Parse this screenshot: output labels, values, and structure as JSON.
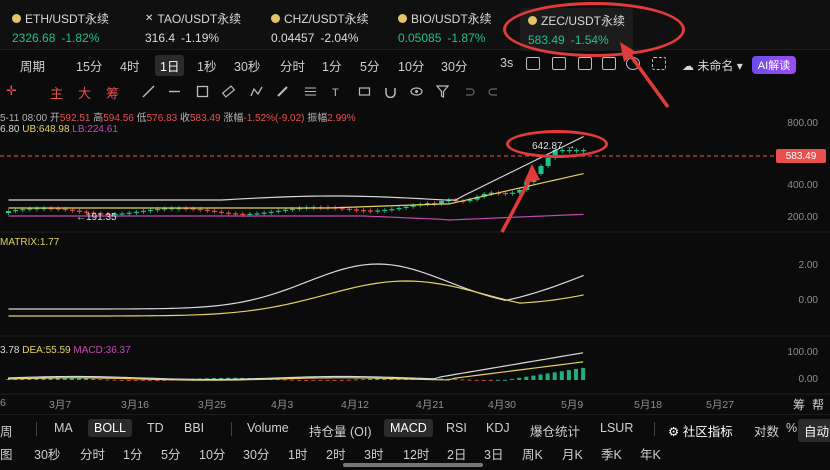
{
  "tickers": [
    {
      "name": "ETH/USDT永续",
      "price": "2326.68",
      "change": "-1.82%",
      "icon": "coin-dot-icon",
      "price_color": "up"
    },
    {
      "name": "TAO/USDT永续",
      "price": "316.4",
      "change": "-1.19%",
      "icon": "x-icon",
      "price_color": "white"
    },
    {
      "name": "CHZ/USDT永续",
      "price": "0.04457",
      "change": "-2.04%",
      "icon": "coin-dot-icon",
      "price_color": "white"
    },
    {
      "name": "BIO/USDT永续",
      "price": "0.05085",
      "change": "-1.87%",
      "icon": "coin-dot-icon",
      "price_color": "up"
    },
    {
      "name": "ZEC/USDT永续",
      "price": "583.49",
      "change": "-1.54%",
      "icon": "coin-dot-icon",
      "price_color": "up"
    }
  ],
  "timeframes": {
    "period_label": "周期",
    "items": [
      "15分",
      "4时",
      "1日",
      "1秒",
      "30秒",
      "分时",
      "1分",
      "5分",
      "10分",
      "30分"
    ],
    "selected": "1日",
    "extra": "3s"
  },
  "toolbar_right": {
    "unnamed": "未命名",
    "ai_label": "AI解读"
  },
  "drawbar": {
    "items": [
      "主",
      "大",
      "筹"
    ]
  },
  "ohlc": {
    "date": "5-11 08:00",
    "open_label": "开",
    "open": "592.51",
    "high_label": "高",
    "high": "594.56",
    "low_label": "低",
    "low": "576.83",
    "close_label": "收",
    "close": "583.49",
    "change_label": "涨幅",
    "change": "-1.52%(-9.02)",
    "amp_label": "振幅",
    "amp": "2.99%"
  },
  "boll": {
    "mid": "6.80",
    "ub": "UB:648.98",
    "lb": "LB:224.61"
  },
  "annotations": {
    "high_marker": "642.87",
    "low_marker": "191.35"
  },
  "current_price": "583.49",
  "price_axis": [
    "800.00",
    "400.00",
    "200.00"
  ],
  "trix": {
    "label": "MATRIX:1.77",
    "axis": [
      "2.00",
      "0.00"
    ]
  },
  "macd": {
    "dif": "3.78",
    "dea": "DEA:55.59",
    "macd": "MACD:36.37",
    "axis": [
      "100.00",
      "0.00"
    ]
  },
  "x_axis": [
    "3月7",
    "3月16",
    "3月25",
    "4月3",
    "4月12",
    "4月21",
    "4月30",
    "5月9",
    "5月18",
    "5月27"
  ],
  "x_axis_left": "6",
  "right_labels": {
    "a": "筹",
    "b": "帮"
  },
  "indicators": {
    "items": [
      "MA",
      "BOLL",
      "TD",
      "BBI",
      "Volume",
      "持仓量 (OI)",
      "MACD",
      "RSI",
      "KDJ",
      "爆仓统计",
      "LSUR"
    ],
    "selected": [
      "BOLL",
      "MACD"
    ],
    "community": "社区指标",
    "log": "对数",
    "pct": "%",
    "auto": "自动",
    "left_edge": "周"
  },
  "periods": [
    "30秒",
    "分时",
    "1分",
    "5分",
    "10分",
    "30分",
    "1时",
    "2时",
    "3时",
    "12时",
    "2日",
    "3日",
    "周K",
    "月K",
    "季K",
    "年K"
  ],
  "periods_left": "图",
  "colors": {
    "up": "#22c08a",
    "down": "#e8504f",
    "accent": "#e23b3b",
    "boll_mid": "#e3d266",
    "boll_ub": "#d8d8d8",
    "boll_lb": "#c04ab0"
  }
}
